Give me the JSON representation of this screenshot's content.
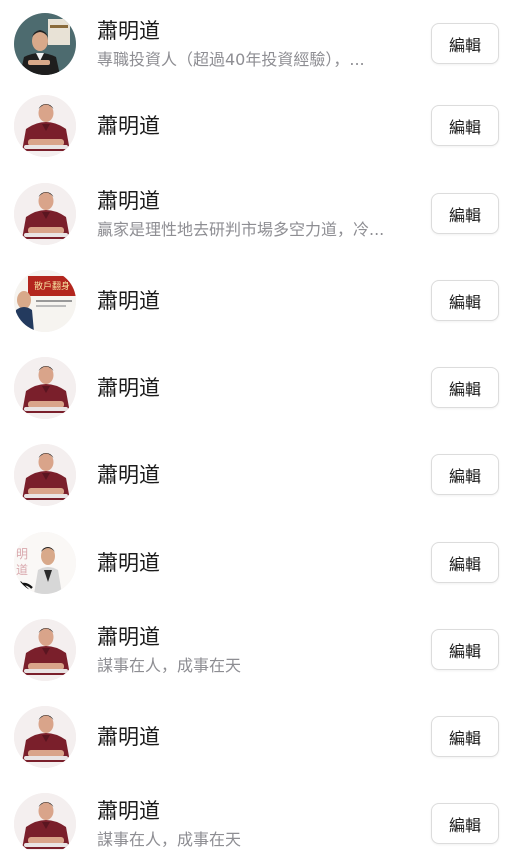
{
  "rows": [
    {
      "name": "蕭明道",
      "bio": "專職投資人（超過40年投資經驗），...",
      "button": "編輯",
      "avatar": "portrait-dark-suit-icon"
    },
    {
      "name": "蕭明道",
      "bio": "",
      "button": "編輯",
      "avatar": "portrait-maroon-shirt-icon"
    },
    {
      "name": "蕭明道",
      "bio": "贏家是理性地去研判市場多空力道，冷...",
      "button": "編輯",
      "avatar": "portrait-maroon-shirt-icon"
    },
    {
      "name": "蕭明道",
      "bio": "",
      "button": "編輯",
      "avatar": "book-cover-red-banner-icon",
      "avatar_text": "散戶翻身"
    },
    {
      "name": "蕭明道",
      "bio": "",
      "button": "編輯",
      "avatar": "portrait-maroon-shirt-icon"
    },
    {
      "name": "蕭明道",
      "bio": "",
      "button": "編輯",
      "avatar": "portrait-maroon-shirt-icon"
    },
    {
      "name": "蕭明道",
      "bio": "",
      "button": "編輯",
      "avatar": "portrait-calligraphy-icon",
      "avatar_text": "明道"
    },
    {
      "name": "蕭明道",
      "bio": "謀事在人，成事在天",
      "button": "編輯",
      "avatar": "portrait-maroon-shirt-icon"
    },
    {
      "name": "蕭明道",
      "bio": "",
      "button": "編輯",
      "avatar": "portrait-maroon-shirt-icon"
    },
    {
      "name": "蕭明道",
      "bio": "謀事在人，成事在天",
      "button": "編輯",
      "avatar": "portrait-maroon-shirt-icon"
    }
  ],
  "colors": {
    "name_text": "#1b1b1b",
    "bio_text": "#8e8e93",
    "button_border": "#dcdcdc",
    "shirt": "#7a1f2b",
    "banner": "#b3261e"
  }
}
